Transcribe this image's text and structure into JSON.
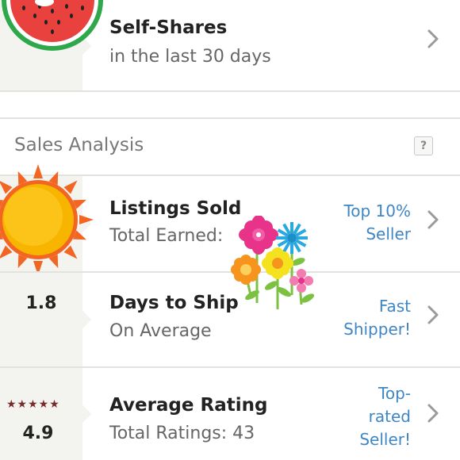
{
  "self_shares": {
    "title": "Self-Shares",
    "subtitle": "in the last 30 days",
    "icon": "watermelon-icon"
  },
  "sales_analysis": {
    "section_title": "Sales Analysis",
    "help_label": "?",
    "rows": [
      {
        "icon": "sun-icon",
        "title": "Listings Sold",
        "subtitle": "Total Earned:",
        "badge_lines": [
          "Top 10%",
          "Seller"
        ]
      },
      {
        "metric": "1.8",
        "title": "Days to Ship",
        "subtitle": "On Average",
        "badge_lines": [
          "Fast",
          "Shipper!"
        ]
      },
      {
        "stars": "★★★★★",
        "metric": "4.9",
        "title": "Average Rating",
        "subtitle": "Total Ratings: 43",
        "badge_lines": [
          "Top-",
          "rated",
          "Seller!"
        ]
      }
    ]
  },
  "decorations": {
    "flowers_sticker": "flowers-sticker-icon"
  },
  "colors": {
    "link_blue": "#3f86c4",
    "left_column_bg": "#f3f3ef",
    "star_color": "#7a2b2b",
    "sun_orange": "#f26522",
    "sun_yellow": "#f7b500",
    "watermelon_red": "#e8413e",
    "watermelon_green": "#2ea84a"
  }
}
